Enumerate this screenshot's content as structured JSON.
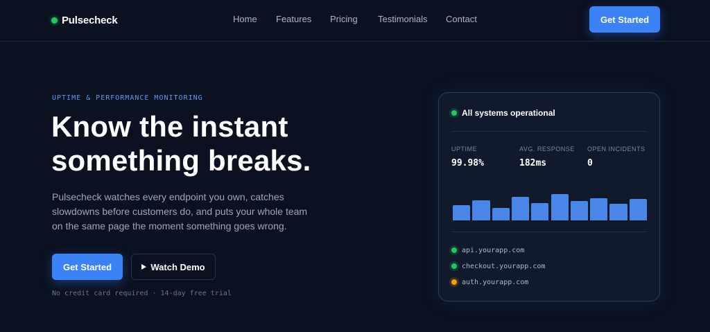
{
  "brand": {
    "name": "Pulsecheck",
    "dot_color": "#22c55e"
  },
  "nav": {
    "links": [
      "Home",
      "Features",
      "Pricing",
      "Testimonials",
      "Contact"
    ],
    "cta_label": "Get Started"
  },
  "hero": {
    "eyebrow": "UPTIME & PERFORMANCE MONITORING",
    "headline_line1": "Know the instant",
    "headline_line2": "something breaks.",
    "subtext": "Pulsecheck watches every endpoint you own, catches slowdowns before customers do, and puts your whole team on the same page the moment something goes wrong.",
    "primary_cta": "Get Started",
    "secondary_cta": "Watch Demo",
    "fine_print": "No credit card required · 14-day free trial"
  },
  "status_card": {
    "status_text": "All systems operational",
    "stats": [
      {
        "label": "UPTIME",
        "value": "99.98%"
      },
      {
        "label": "AVG. RESPONSE",
        "value": "182ms"
      },
      {
        "label": "OPEN INCIDENTS",
        "value": "0"
      }
    ],
    "response_bars": [
      0.5,
      0.66,
      0.41,
      0.77,
      0.57,
      0.86,
      0.64,
      0.73,
      0.55,
      0.7
    ],
    "endpoints": [
      {
        "host": "api.yourapp.com",
        "status": "up"
      },
      {
        "host": "checkout.yourapp.com",
        "status": "up"
      },
      {
        "host": "auth.yourapp.com",
        "status": "degraded"
      }
    ]
  },
  "colors": {
    "background": "#0b1121",
    "accent": "#3b82f6",
    "status_up": "#22c55e",
    "status_degraded": "#f59e0b"
  }
}
